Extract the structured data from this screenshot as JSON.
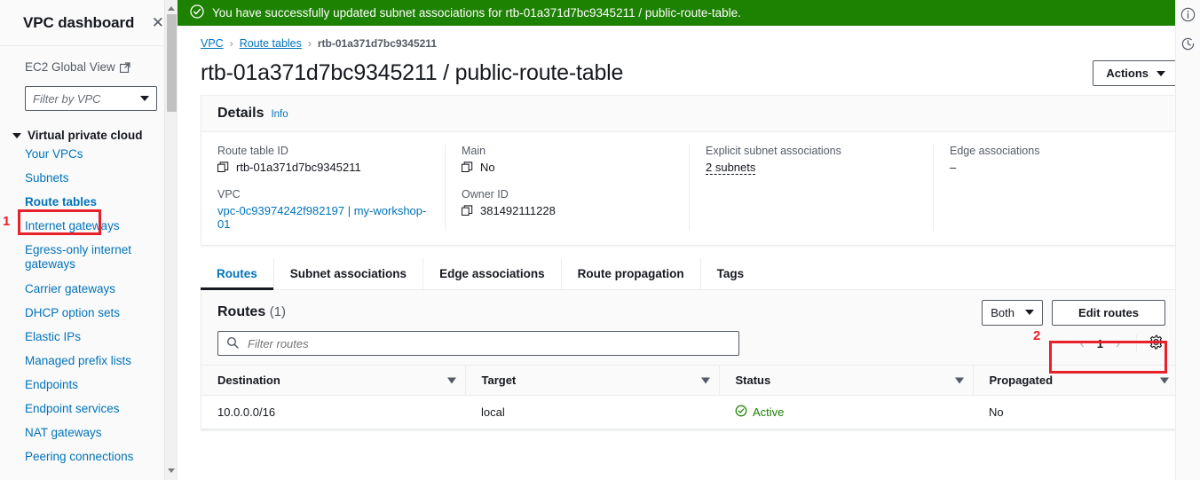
{
  "sidebar": {
    "title": "VPC dashboard",
    "close_label": "✕",
    "global_view": "EC2 Global View",
    "vpc_filter_placeholder": "Filter by VPC",
    "group_label": "Virtual private cloud",
    "items": [
      {
        "label": "Your VPCs"
      },
      {
        "label": "Subnets"
      },
      {
        "label": "Route tables"
      },
      {
        "label": "Internet gateways"
      },
      {
        "label": "Egress-only internet gateways"
      },
      {
        "label": "Carrier gateways"
      },
      {
        "label": "DHCP option sets"
      },
      {
        "label": "Elastic IPs"
      },
      {
        "label": "Managed prefix lists"
      },
      {
        "label": "Endpoints"
      },
      {
        "label": "Endpoint services"
      },
      {
        "label": "NAT gateways"
      },
      {
        "label": "Peering connections"
      }
    ]
  },
  "annotations": {
    "marker_one": "1",
    "marker_two": "2"
  },
  "flash": {
    "message": "You have successfully updated subnet associations for rtb-01a371d7bc9345211 / public-route-table.",
    "dismiss_label": "✕",
    "color": "#1d8102"
  },
  "breadcrumb": {
    "items": [
      {
        "label": "VPC",
        "link": true
      },
      {
        "label": "Route tables",
        "link": true
      },
      {
        "label": "rtb-01a371d7bc9345211",
        "link": false
      }
    ],
    "separator": "›"
  },
  "header": {
    "title": "rtb-01a371d7bc9345211 / public-route-table",
    "actions_label": "Actions"
  },
  "details": {
    "heading": "Details",
    "info_label": "Info",
    "columns": [
      {
        "fields": [
          {
            "label": "Route table ID",
            "value": "rtb-01a371d7bc9345211",
            "copy": true,
            "link": false
          },
          {
            "label": "VPC",
            "value": "vpc-0c93974242f982197 | my-workshop-01",
            "copy": false,
            "link": true
          }
        ]
      },
      {
        "fields": [
          {
            "label": "Main",
            "value": "No",
            "copy": true,
            "link": false
          },
          {
            "label": "Owner ID",
            "value": "381492111228",
            "copy": true,
            "link": false
          }
        ]
      },
      {
        "fields": [
          {
            "label": "Explicit subnet associations",
            "value": "2 subnets",
            "copy": false,
            "link": false,
            "dashed": true
          }
        ]
      },
      {
        "fields": [
          {
            "label": "Edge associations",
            "value": "–",
            "copy": false,
            "link": false
          }
        ]
      }
    ]
  },
  "tabs": [
    {
      "label": "Routes",
      "active": true
    },
    {
      "label": "Subnet associations",
      "active": false
    },
    {
      "label": "Edge associations",
      "active": false
    },
    {
      "label": "Route propagation",
      "active": false
    },
    {
      "label": "Tags",
      "active": false
    }
  ],
  "routes_panel": {
    "title": "Routes",
    "count": "(1)",
    "filter_select": "Both",
    "edit_button": "Edit routes",
    "search_placeholder": "Filter routes",
    "search_value": "",
    "page_number": "1",
    "prev_label": "‹",
    "next_label": "›",
    "columns": [
      "Destination",
      "Target",
      "Status",
      "Propagated"
    ],
    "rows": [
      {
        "destination": "10.0.0.0/16",
        "target": "local",
        "status": "Active",
        "propagated": "No"
      }
    ],
    "status_color": "#1d8102"
  },
  "right_rail": {
    "icons": [
      "info-icon",
      "history-icon"
    ]
  }
}
